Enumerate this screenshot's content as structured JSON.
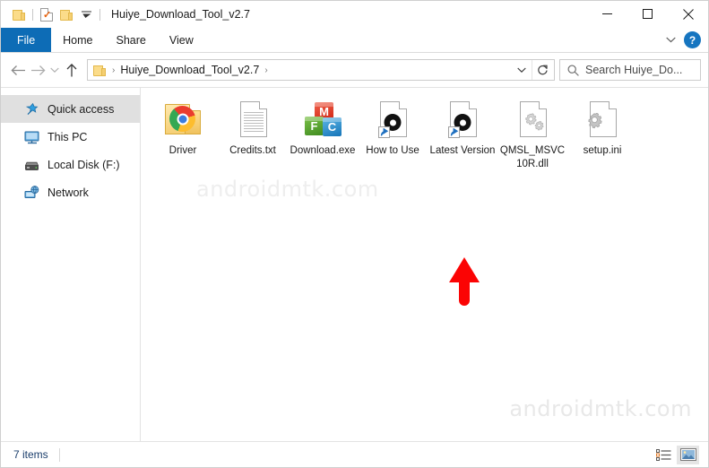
{
  "window": {
    "title": "Huiye_Download_Tool_v2.7",
    "quick_access": [
      {
        "name": "folder-icon",
        "label": "Folder"
      },
      {
        "name": "properties-icon",
        "label": "Properties"
      },
      {
        "name": "new-folder-icon",
        "label": "New folder"
      },
      {
        "name": "customize-caret-icon",
        "label": "Customize Quick Access Toolbar"
      }
    ],
    "controls": {
      "minimize": "Minimize",
      "maximize": "Maximize",
      "close": "Close"
    }
  },
  "ribbon": {
    "tabs": [
      {
        "label": "File",
        "active": true
      },
      {
        "label": "Home",
        "active": false
      },
      {
        "label": "Share",
        "active": false
      },
      {
        "label": "View",
        "active": false
      }
    ],
    "collapse_label": "Minimize the Ribbon",
    "help_label": "?"
  },
  "address": {
    "back_label": "Back",
    "forward_label": "Forward",
    "recent_label": "Recent locations",
    "up_label": "Up",
    "breadcrumb": [
      {
        "label": "Huiye_Download_Tool_v2.7"
      }
    ],
    "separator": "›",
    "dropdown_label": "Previous locations",
    "refresh_label": "Refresh"
  },
  "search": {
    "placeholder": "Search Huiye_Do...",
    "value": ""
  },
  "sidebar": {
    "items": [
      {
        "label": "Quick access",
        "icon": "star-pin-icon",
        "selected": true
      },
      {
        "label": "This PC",
        "icon": "computer-icon",
        "selected": false
      },
      {
        "label": "Local Disk (F:)",
        "icon": "drive-icon",
        "selected": false
      },
      {
        "label": "Network",
        "icon": "network-icon",
        "selected": false
      }
    ]
  },
  "files": [
    {
      "name": "Driver",
      "icon": "folder-chrome-icon",
      "type": "folder"
    },
    {
      "name": "Credits.txt",
      "icon": "text-document-icon",
      "type": "file"
    },
    {
      "name": "Download.exe",
      "icon": "mfc-application-icon",
      "type": "application"
    },
    {
      "name": "How to Use",
      "icon": "internet-shortcut-icon",
      "type": "shortcut"
    },
    {
      "name": "Latest Version",
      "icon": "internet-shortcut-icon",
      "type": "shortcut"
    },
    {
      "name": "QMSL_MSVC10R.dll",
      "icon": "dll-gears-icon",
      "type": "file"
    },
    {
      "name": "setup.ini",
      "icon": "configuration-gear-icon",
      "type": "file"
    }
  ],
  "annotation": {
    "type": "arrow-up",
    "color": "#fb0404",
    "points_at": "Download.exe"
  },
  "watermark": {
    "text": "androidmtk.com"
  },
  "statusbar": {
    "item_count": "7 items",
    "views": [
      {
        "label": "Details view",
        "icon": "details-view-icon",
        "active": false
      },
      {
        "label": "Large icons view",
        "icon": "large-icons-view-icon",
        "active": true
      }
    ]
  },
  "colors": {
    "accent": "#0d6cb6",
    "selection": "#e0e0e0",
    "marker": "#fb0404"
  }
}
